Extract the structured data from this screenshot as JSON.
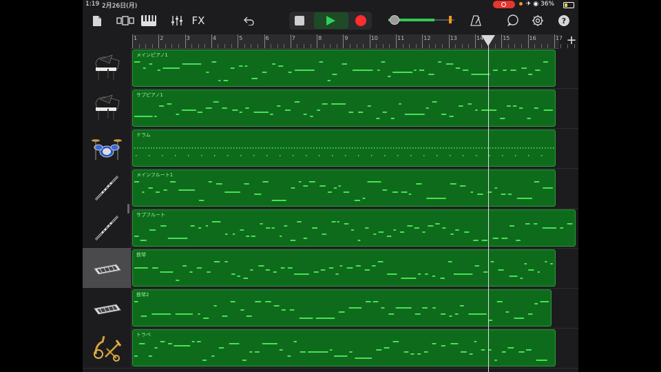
{
  "status_bar": {
    "time": "1:19",
    "date": "2月26日(月)",
    "battery": "36%",
    "battery_level": 0.36
  },
  "toolbar": {
    "fx_label": "FX",
    "volume_level": 0.7,
    "icons": [
      "document-icon",
      "view-toggle-icon",
      "piano-keys-icon",
      "mixer-icon",
      "undo-icon",
      "stop-icon",
      "play-icon",
      "record-icon",
      "metronome-icon",
      "loop-icon",
      "settings-icon",
      "help-icon"
    ]
  },
  "ruler": {
    "bars": [
      "1",
      "2",
      "3",
      "4",
      "5",
      "6",
      "7",
      "8",
      "9",
      "10",
      "11",
      "12",
      "13",
      "14",
      "15",
      "16",
      "17"
    ],
    "playhead_bar": 14.5
  },
  "add_track_label": "+",
  "tracks": [
    {
      "name": "メインピアノ1",
      "instrument": "grand-piano-icon",
      "end_bar": 17.0
    },
    {
      "name": "サブピアノ1",
      "instrument": "grand-piano-icon",
      "end_bar": 17.0
    },
    {
      "name": "ドラム",
      "instrument": "drum-kit-icon",
      "end_bar": 17.0
    },
    {
      "name": "メインフルート1",
      "instrument": "flute-icon",
      "end_bar": 17.0
    },
    {
      "name": "サブフルート",
      "instrument": "flute-icon",
      "end_bar": 17.75
    },
    {
      "name": "鉄琴",
      "instrument": "glockenspiel-icon",
      "end_bar": 17.0,
      "selected": true
    },
    {
      "name": "鉄琴2",
      "instrument": "glockenspiel-icon",
      "end_bar": 16.85
    },
    {
      "name": "トラペ",
      "instrument": "brass-icon",
      "end_bar": 17.0
    }
  ],
  "colors": {
    "region_fill": "#0f6b1c",
    "region_border": "#2a9a3a",
    "note": "#4cf05c",
    "play": "#2ed158",
    "record": "#ff2d2d"
  }
}
